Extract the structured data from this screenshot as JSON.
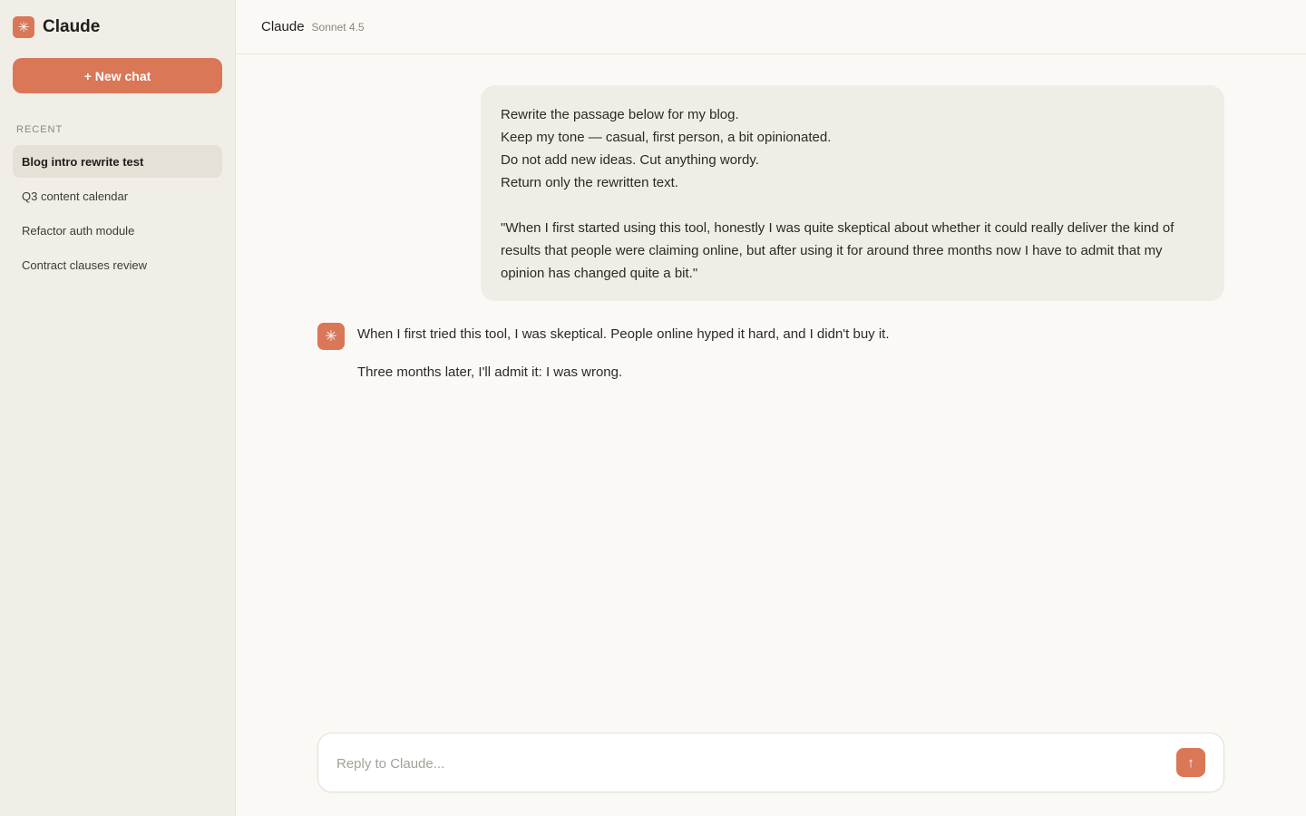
{
  "sidebar": {
    "brand_name": "Claude",
    "brand_icon": "✳",
    "new_chat_label": "+ New chat",
    "recent_label": "RECENT",
    "recent_items": [
      {
        "label": "Blog intro rewrite test",
        "active": true
      },
      {
        "label": "Q3 content calendar",
        "active": false
      },
      {
        "label": "Refactor auth module",
        "active": false
      },
      {
        "label": "Contract clauses review",
        "active": false
      }
    ]
  },
  "header": {
    "title": "Claude",
    "model": "Sonnet 4.5"
  },
  "conversation": {
    "user_message": {
      "lines": [
        "Rewrite the passage below for my blog.",
        "Keep my tone — casual, first person, a bit opinionated.",
        "Do not add new ideas. Cut anything wordy.",
        "Return only the rewritten text."
      ],
      "quote": "\"When I first started using this tool, honestly I was quite skeptical about whether it could really deliver the kind of results that people were claiming online, but after using it for around three months now I have to admit that my opinion has changed quite a bit.\""
    },
    "assistant_message": {
      "avatar_icon": "✳",
      "paragraphs": [
        "When I first tried this tool, I was skeptical. People online hyped it hard, and I didn't buy it.",
        "Three months later, I'll admit it: I was wrong."
      ]
    }
  },
  "composer": {
    "placeholder": "Reply to Claude...",
    "value": "",
    "send_icon": "↑"
  },
  "colors": {
    "accent": "#d97757",
    "sidebar_bg": "#f0eee6",
    "main_bg": "#faf9f5",
    "user_bubble_bg": "#efede5"
  }
}
